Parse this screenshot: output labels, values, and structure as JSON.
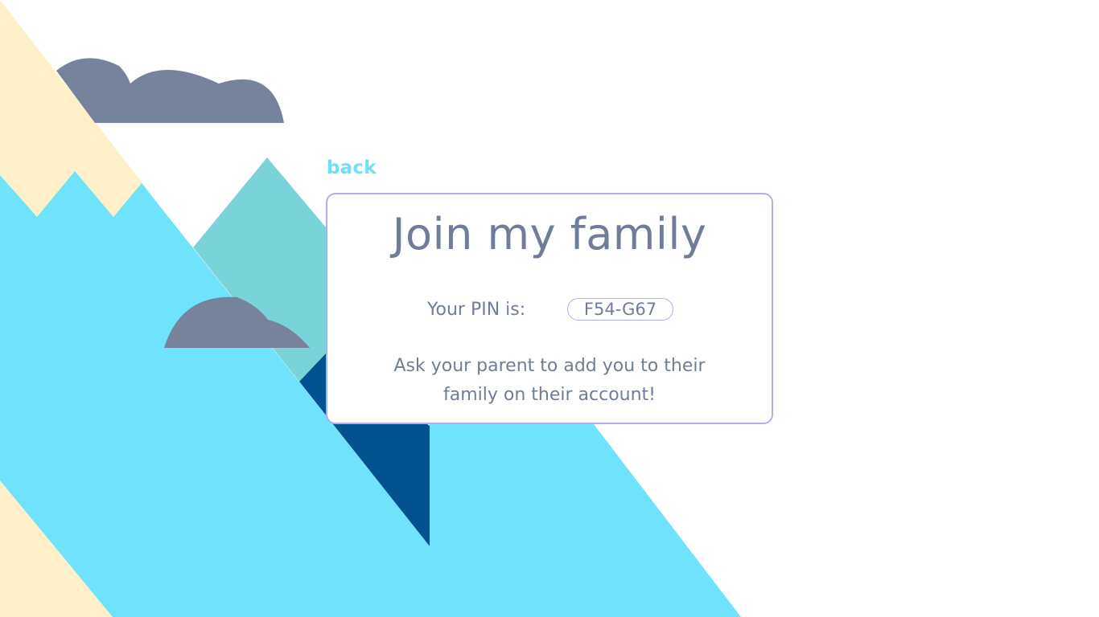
{
  "navigation": {
    "back_label": "back"
  },
  "card": {
    "title": "Join my family",
    "pin_label": "Your PIN is:",
    "pin_value": "F54-G67",
    "instructions": "Ask your parent to add you to their family on their account!"
  },
  "colors": {
    "accent": "#6fe0f7",
    "text": "#6f7d98",
    "card_border": "#b1aef0",
    "cream": "#fff0c9",
    "sky_blue": "#6fe0f7",
    "teal": "#7bd3da",
    "navy": "#01528e",
    "cloud": "#77839b"
  }
}
